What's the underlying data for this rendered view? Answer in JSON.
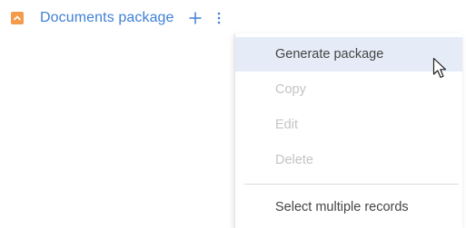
{
  "header": {
    "title": "Documents package",
    "collapse_icon": "chevron-up-icon",
    "add_icon": "plus-icon",
    "more_icon": "vertical-ellipsis-icon"
  },
  "colors": {
    "accent_orange": "#f39a4b",
    "link_blue": "#3f7fd6",
    "menu_highlight": "#e5ecf8",
    "disabled_text": "#c4c4c4"
  },
  "menu": {
    "items": [
      {
        "label": "Generate package",
        "state": "highlighted"
      },
      {
        "label": "Copy",
        "state": "disabled"
      },
      {
        "label": "Edit",
        "state": "disabled"
      },
      {
        "label": "Delete",
        "state": "disabled"
      },
      {
        "label": "Select multiple records",
        "state": "enabled"
      }
    ]
  },
  "pointer": {
    "icon": "mouse-pointer-icon"
  }
}
